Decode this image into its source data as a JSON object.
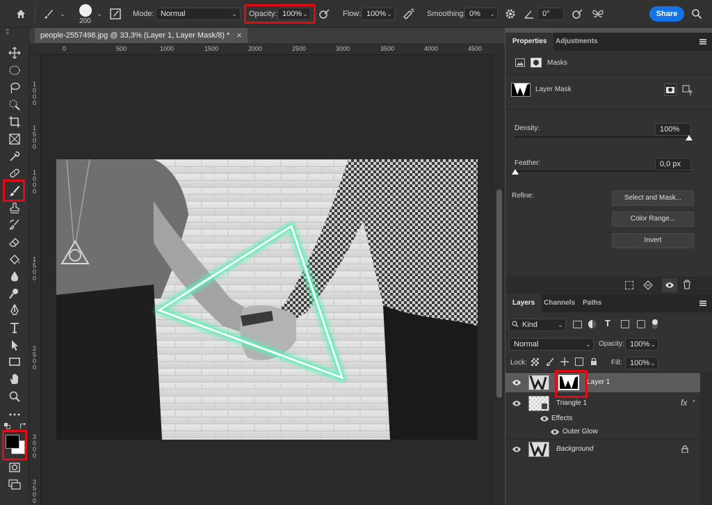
{
  "options_bar": {
    "brush_size": "200",
    "mode_label": "Mode:",
    "mode_value": "Normal",
    "opacity_label": "Opacity:",
    "opacity_value": "100%",
    "flow_label": "Flow:",
    "flow_value": "100%",
    "smoothing_label": "Smoothing:",
    "smoothing_value": "0%",
    "angle_value": "0°",
    "share_label": "Share"
  },
  "document": {
    "tab_title": "people-2557498.jpg @ 33,3% (Layer 1, Layer Mask/8) *",
    "close_glyph": "×",
    "ruler_h": [
      "0",
      "500",
      "1000",
      "1500",
      "2000",
      "2500",
      "3000",
      "3500",
      "4000",
      "4500"
    ],
    "ruler_v": [
      "1\n0\n0\n0",
      "1\n5\n0\n0",
      "2\n0\n0\n0",
      "2\n5\n0\n0",
      "3\n0\n0\n0",
      "3\n5\n0\n0"
    ]
  },
  "properties": {
    "tabs": [
      "Properties",
      "Adjustments"
    ],
    "masks_label": "Masks",
    "layer_mask_label": "Layer Mask",
    "density_label": "Density:",
    "density_value": "100%",
    "density_fraction": 1.0,
    "feather_label": "Feather:",
    "feather_value": "0,0 px",
    "feather_fraction": 0.0,
    "refine_label": "Refine:",
    "buttons": [
      "Select and Mask...",
      "Color Range...",
      "Invert"
    ]
  },
  "layers": {
    "tabs": [
      "Layers",
      "Channels",
      "Paths"
    ],
    "kind_label": "Kind",
    "blend_mode": "Normal",
    "opacity_label": "Opacity:",
    "opacity_value": "100%",
    "lock_label": "Lock:",
    "fill_label": "Fill:",
    "fill_value": "100%",
    "items": [
      {
        "name": "Layer 1"
      },
      {
        "name": "Triangle 1",
        "fx": "fx"
      },
      {
        "name": "Effects"
      },
      {
        "name": "Outer Glow"
      },
      {
        "name": "Background"
      }
    ]
  },
  "colors": {
    "accent": "#1473e6",
    "highlight": "#e50914",
    "glow": "#5cf0b4"
  }
}
